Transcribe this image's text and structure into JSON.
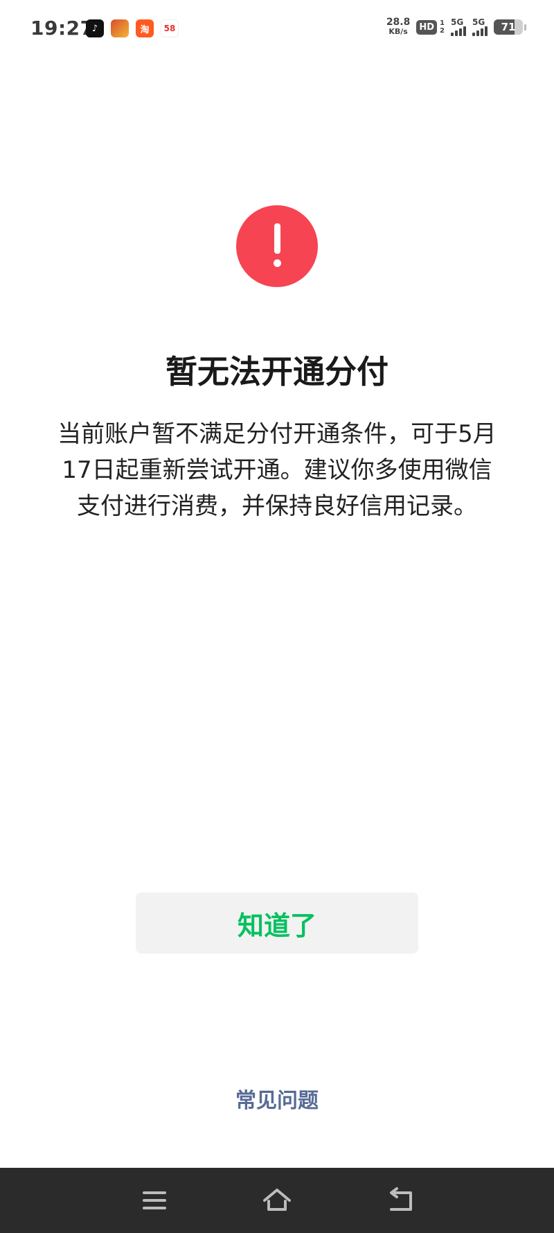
{
  "status_bar": {
    "time": "19:27",
    "notifications": [
      {
        "icon": "tiktok-icon",
        "text": "♪"
      },
      {
        "icon": "game-icon",
        "text": ""
      },
      {
        "icon": "taobao-icon",
        "text": "淘"
      },
      {
        "icon": "app-58-icon",
        "text": "58"
      }
    ],
    "net_speed_value": "28.8",
    "net_speed_unit": "KB/s",
    "hd_label": "HD",
    "sim_slot_top": "1",
    "sim_slot_bottom": "2",
    "sim1_label": "5G",
    "sim2_label": "5G",
    "battery_level": "71",
    "battery_percent": 71
  },
  "alert": {
    "icon": "exclamation-circle-icon",
    "color": "#f64452"
  },
  "main": {
    "title": "暂无法开通分付",
    "message": "当前账户暂不满足分付开通条件，可于5月17日起重新尝试开通。建议你多使用微信支付进行消费，并保持良好信用记录。",
    "confirm_label": "知道了",
    "faq_label": "常见问题"
  },
  "colors": {
    "accent_green": "#07c160",
    "link_blue": "#576b95",
    "button_bg": "#f2f2f2",
    "nav_bg": "#2b2b2b"
  },
  "nav": {
    "menu_icon": "menu-icon",
    "home_icon": "home-icon",
    "back_icon": "back-icon"
  }
}
